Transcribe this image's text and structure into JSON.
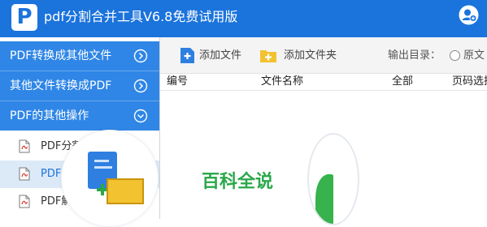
{
  "app": {
    "logo_letter": "P",
    "title": "pdf分割合并工具V6.8免费试用版",
    "brand_color": "#1b73dc"
  },
  "sidebar": {
    "main_items": [
      {
        "label": "PDF转换成其他文件",
        "state": "collapsed"
      },
      {
        "label": "其他文件转换成PDF",
        "state": "collapsed"
      },
      {
        "label": "PDF的其他操作",
        "state": "expanded"
      }
    ],
    "sub_items": [
      {
        "label": "PDF分割",
        "active": false
      },
      {
        "label": "PDF合并",
        "active": true
      },
      {
        "label": "PDF解除密码",
        "active": false
      }
    ]
  },
  "toolbar": {
    "add_file_label": "添加文件",
    "add_folder_label": "添加文件夹",
    "output_dir_label": "输出目录：",
    "radio_option_label": "原文"
  },
  "table": {
    "columns": [
      "编号",
      "文件名称",
      "全部",
      "页码选择"
    ]
  },
  "promo": {
    "text": "百科全说"
  }
}
